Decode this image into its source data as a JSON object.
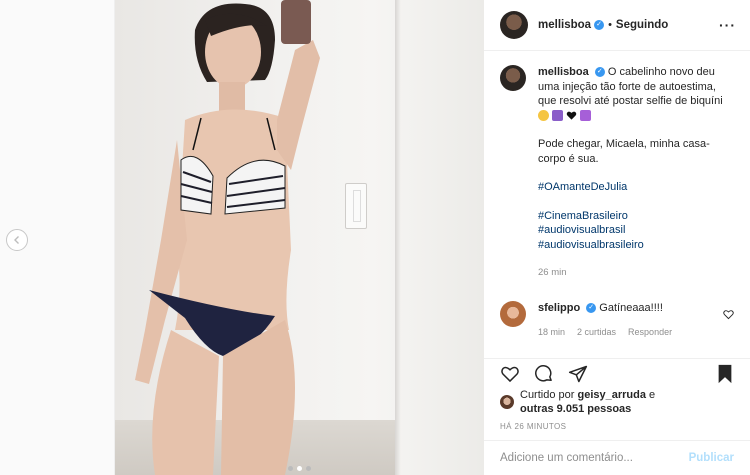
{
  "header": {
    "username": "mellisboa",
    "follow_status": "Seguindo",
    "separator": "•"
  },
  "caption": {
    "username": "mellisboa",
    "text": "O cabelinho novo deu uma injeção tão forte de autoestima, que resolvi até postar selfie de biquíni",
    "emojis": [
      "grinning-sweat-face",
      "woman-scientist",
      "black-heart",
      "purple-sparkle"
    ],
    "paragraph2": "Pode chegar, Micaela, minha casa-corpo é sua.",
    "hashtag1": "#OAmanteDeJulia",
    "hashtags": [
      "#CinemaBrasileiro",
      "#audiovisualbrasil",
      "#audiovisualbrasileiro"
    ],
    "age": "26 min"
  },
  "comment": {
    "username": "sfelippo",
    "text": "Gatíneaaa!!!!",
    "age": "18 min",
    "likes": "2 curtidas",
    "reply": "Responder"
  },
  "likes": {
    "prefix": "Curtido por",
    "user": "geisy_arruda",
    "conj": "e",
    "others": "outras 9.051 pessoas"
  },
  "timestamp": "HÁ 26 MINUTOS",
  "add_comment": {
    "placeholder": "Adicione um comentário...",
    "publish": "Publicar"
  },
  "carousel": {
    "count": 3,
    "active": 2
  },
  "colors": {
    "accent": "#3897f0",
    "link": "#00376b",
    "muted": "#8e8e8e",
    "publish_disabled": "#b2dffc"
  }
}
